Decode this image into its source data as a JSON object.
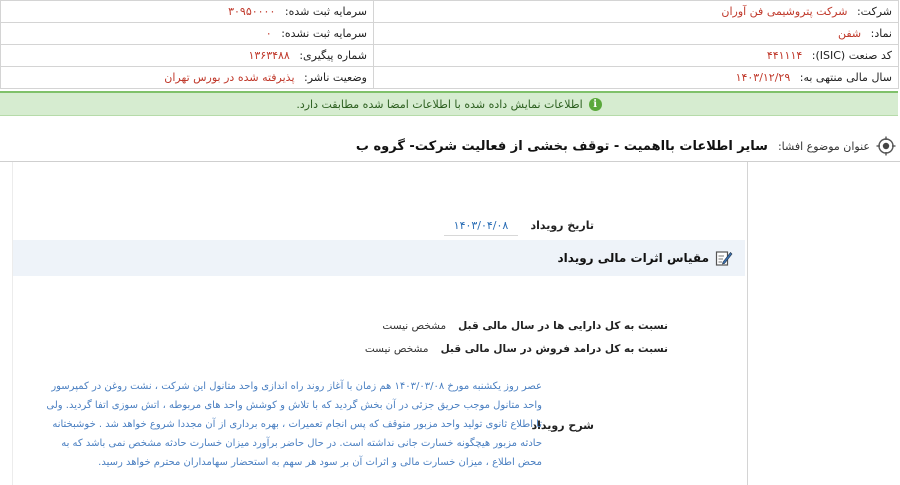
{
  "info": {
    "company_label": "شرکت:",
    "company_value": "شرکت پتروشیمی فن آوران",
    "reg_capital_label": "سرمایه ثبت شده:",
    "reg_capital_value": "۳۰۹۵۰۰۰۰",
    "symbol_label": "نماد:",
    "symbol_value": "شفن",
    "unreg_capital_label": "سرمایه ثبت نشده:",
    "unreg_capital_value": "۰",
    "isic_label": "کد صنعت (ISIC):",
    "isic_value": "۴۴۱۱۱۴",
    "tracking_label": "شماره پیگیری:",
    "tracking_value": "۱۳۶۳۴۸۸",
    "fiscal_label": "سال مالی منتهی به:",
    "fiscal_value": "۱۴۰۳/۱۲/۲۹",
    "status_label": "وضعیت ناشر:",
    "status_value": "پذیرفته شده در بورس تهران"
  },
  "notice": {
    "icon": "info-icon",
    "text": "اطلاعات نمایش داده شده با اطلاعات امضا شده مطابقت دارد."
  },
  "subject": {
    "icon": "target-icon",
    "label": "عنوان موضوع افشا:",
    "title": "سایر اطلاعات بااهمیت - توقف بخشی از فعالیت شرکت- گروه ب"
  },
  "event_date": {
    "label": "تاریخ رویداد",
    "value": "۱۴۰۳/۰۴/۰۸"
  },
  "financial_section": {
    "icon": "edit-icon",
    "title": "مقیاس اثرات مالی رویداد",
    "ratios": [
      {
        "label": "نسبت به کل دارایی ها در سال مالی قبل",
        "value": "مشخص نیست"
      },
      {
        "label": "نسبت به کل درامد فروش در سال مالی قبل",
        "value": "مشخص نیست"
      }
    ]
  },
  "description": {
    "label": "شرح رویداد",
    "text": "عصر روز یکشنبه مورخ ۱۴۰۳/۰۳/۰۸ هم زمان با آغاز روند راه اندازی واحد متانول این شرکت ، نشت روغن در کمپرسور واحد متانول موجب حریق جزئی در آن بخش گردید که با تلاش و کوشش واحد های مربوطه ، اتش سوزی اتفا گردید. ولی تا اطلاع ثانوی تولید واحد مزبور متوقف که پس انجام تعمیرات ، بهره برداری از آن مجددا شروع خواهد شد . خوشبختانه حادثه مزبور هیچگونه خسارت جانی نداشته است. در حال حاضر برآورد میزان خسارت حادثه مشخص نمی باشد که به محض اطلاع ، میزان خسارت مالی و اثرات آن بر سود هر سهم به استحضار سهامداران محترم خواهد رسید."
  }
}
